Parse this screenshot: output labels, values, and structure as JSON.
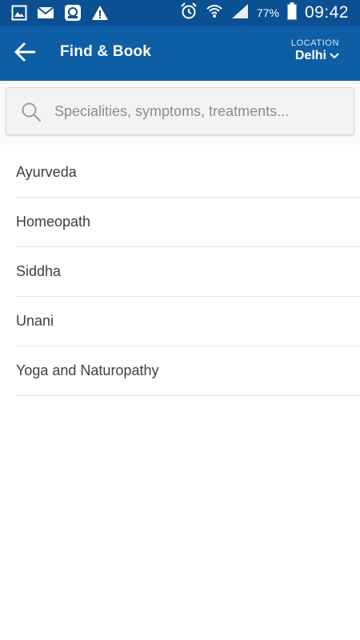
{
  "status_bar": {
    "battery_percent": "77%",
    "time": "09:42",
    "icons_left": [
      "gallery-icon",
      "mail-icon",
      "app-icon",
      "warning-icon"
    ],
    "icons_right": [
      "alarm-icon",
      "wifi-icon",
      "signal-icon",
      "battery-icon"
    ]
  },
  "header": {
    "title": "Find & Book",
    "location_label": "LOCATION",
    "location_value": "Delhi"
  },
  "search": {
    "placeholder": "Specialities, symptoms, treatments..."
  },
  "categories": [
    {
      "label": "Ayurveda"
    },
    {
      "label": "Homeopath"
    },
    {
      "label": "Siddha"
    },
    {
      "label": "Unani"
    },
    {
      "label": "Yoga and Naturopathy"
    }
  ],
  "colors": {
    "status_bar": "#0b5092",
    "app_bar": "#0e5ea6",
    "divider": "#e3e4e6",
    "text": "#3d3f42"
  }
}
